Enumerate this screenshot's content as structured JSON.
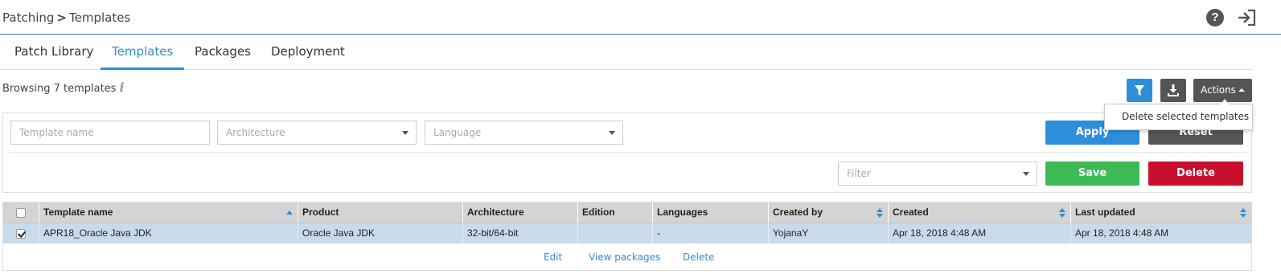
{
  "breadcrumb": {
    "section": "Patching",
    "separator": ">",
    "page": "Templates"
  },
  "header": {
    "help_icon": "question-circle-icon",
    "help_glyph": "?",
    "signout_icon": "sign-out-icon"
  },
  "tabs": [
    {
      "label": "Patch Library",
      "active": false
    },
    {
      "label": "Templates",
      "active": true
    },
    {
      "label": "Packages",
      "active": false
    },
    {
      "label": "Deployment",
      "active": false
    }
  ],
  "browsing": {
    "text": "Browsing 7 templates",
    "info_glyph": "i"
  },
  "toolbar": {
    "filter_icon": "funnel-icon",
    "download_icon": "download-icon",
    "actions_label": "Actions",
    "actions_menu": [
      "Delete selected templates"
    ]
  },
  "filters": {
    "template_name_placeholder": "Template name",
    "architecture_placeholder": "Architecture",
    "language_placeholder": "Language",
    "apply_label": "Apply",
    "reset_label": "Reset",
    "saved_filter_placeholder": "Filter",
    "save_label": "Save",
    "delete_label": "Delete"
  },
  "grid": {
    "columns": [
      "Template name",
      "Product",
      "Architecture",
      "Edition",
      "Languages",
      "Created by",
      "Created",
      "Last updated"
    ],
    "rows": [
      {
        "checked": true,
        "cells": [
          "APR18_Oracle Java JDK",
          "Oracle Java JDK",
          "32-bit/64-bit",
          "",
          "-",
          "YojanaY",
          "Apr 18, 2018 4:48 AM",
          "Apr 18, 2018 4:48 AM"
        ]
      }
    ],
    "row_actions": [
      "Edit",
      "View packages",
      "Delete"
    ]
  },
  "colors": {
    "accent": "#2d8fd9",
    "apply": "#2d8fd9",
    "reset": "#555555",
    "save": "#3cba54",
    "delete": "#c8102e",
    "selected_row": "#c9dbeb"
  }
}
